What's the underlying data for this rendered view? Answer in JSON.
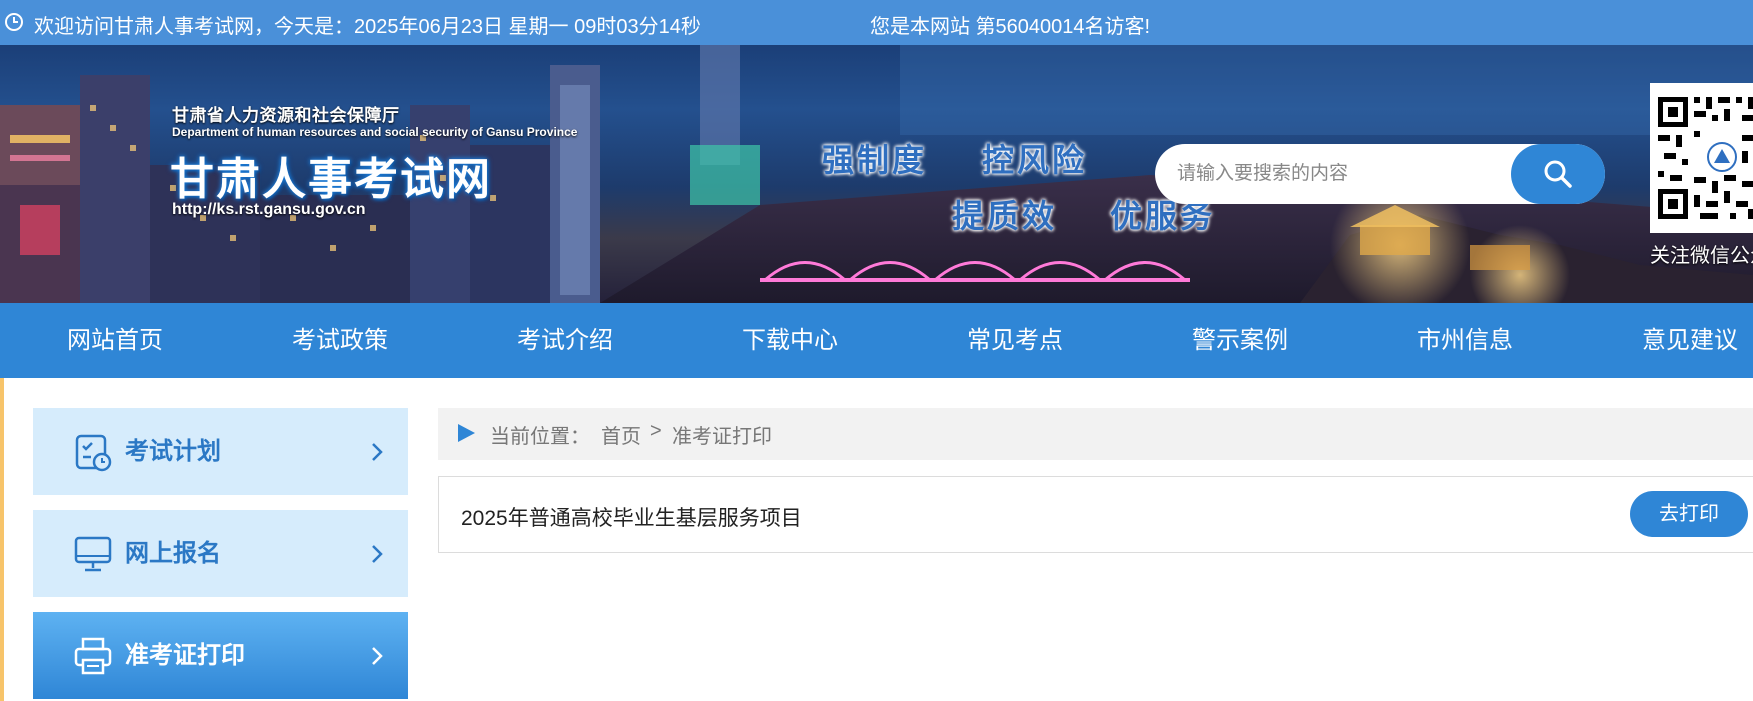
{
  "topbar": {
    "clock_icon": "clock-icon",
    "welcome": "欢迎访问甘肃人事考试网，今天是：2025年06月23日 星期一 09时03分14秒",
    "visitor": "您是本网站 第56040014名访客!"
  },
  "banner": {
    "org_name": "甘肃省人力资源和社会保障厅",
    "org_name_en": "Department of human resources and social security of Gansu Province",
    "site_title": "甘肃人事考试网",
    "site_url": "http://ks.rst.gansu.gov.cn",
    "slogans": [
      "强制度",
      "控风险",
      "提质效",
      "优服务"
    ],
    "search_placeholder": "请输入要搜索的内容",
    "search_icon": "search-icon",
    "qr_label": "关注微信公众号"
  },
  "nav": {
    "items": [
      "网站首页",
      "考试政策",
      "考试介绍",
      "下载中心",
      "常见考点",
      "警示案例",
      "市州信息",
      "意见建议"
    ]
  },
  "sidebar": {
    "items": [
      {
        "label": "考试计划",
        "icon": "calendar-check-icon"
      },
      {
        "label": "网上报名",
        "icon": "monitor-icon"
      },
      {
        "label": "准考证打印",
        "icon": "printer-icon"
      }
    ],
    "active_index": 2
  },
  "breadcrumb": {
    "prefix": "当前位置：",
    "home": "首页",
    "separator": ">",
    "current": "准考证打印"
  },
  "list": {
    "items": [
      {
        "title": "2025年普通高校毕业生基层服务项目",
        "action": "去打印"
      }
    ]
  },
  "colors": {
    "primary": "#2f86d6",
    "topbar": "#4a90d9",
    "sidebar_bg": "#d6ecfc",
    "accent": "#f7c46a"
  }
}
